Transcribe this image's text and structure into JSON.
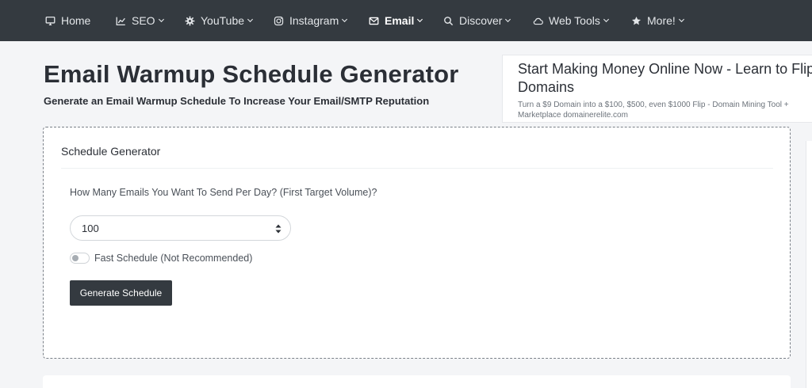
{
  "nav": {
    "items": [
      {
        "label": "Home",
        "icon": "monitor-icon",
        "dropdown": false,
        "active": false
      },
      {
        "label": "SEO",
        "icon": "chart-icon",
        "dropdown": true,
        "active": false
      },
      {
        "label": "YouTube",
        "icon": "gear-icon",
        "dropdown": true,
        "active": false
      },
      {
        "label": "Instagram",
        "icon": "instagram-icon",
        "dropdown": true,
        "active": false
      },
      {
        "label": "Email",
        "icon": "envelope-icon",
        "dropdown": true,
        "active": true
      },
      {
        "label": "Discover",
        "icon": "search-icon",
        "dropdown": true,
        "active": false
      },
      {
        "label": "Web Tools",
        "icon": "cloud-icon",
        "dropdown": true,
        "active": false
      },
      {
        "label": "More!",
        "icon": "star-icon",
        "dropdown": true,
        "active": false
      }
    ]
  },
  "header": {
    "title": "Email Warmup Schedule Generator",
    "subtitle": "Generate an Email Warmup Schedule To Increase Your Email/SMTP Reputation"
  },
  "ad": {
    "title": "Start Making Money Online Now - Learn to Flip Domains",
    "text": "Turn a $9 Domain into a $100, $500, even $1000 Flip - Domain Mining Tool + Marketplace domainerelite.com"
  },
  "generator": {
    "heading": "Schedule Generator",
    "question": "How Many Emails You Want To Send Per Day? (First Target Volume)?",
    "selected_value": "100",
    "toggle_label": "Fast Schedule (Not Recommended)",
    "toggle_on": false,
    "button_label": "Generate Schedule"
  },
  "colors": {
    "navbar_bg": "#343a40",
    "page_bg": "#f4f5f7",
    "button_bg": "#343a40"
  }
}
